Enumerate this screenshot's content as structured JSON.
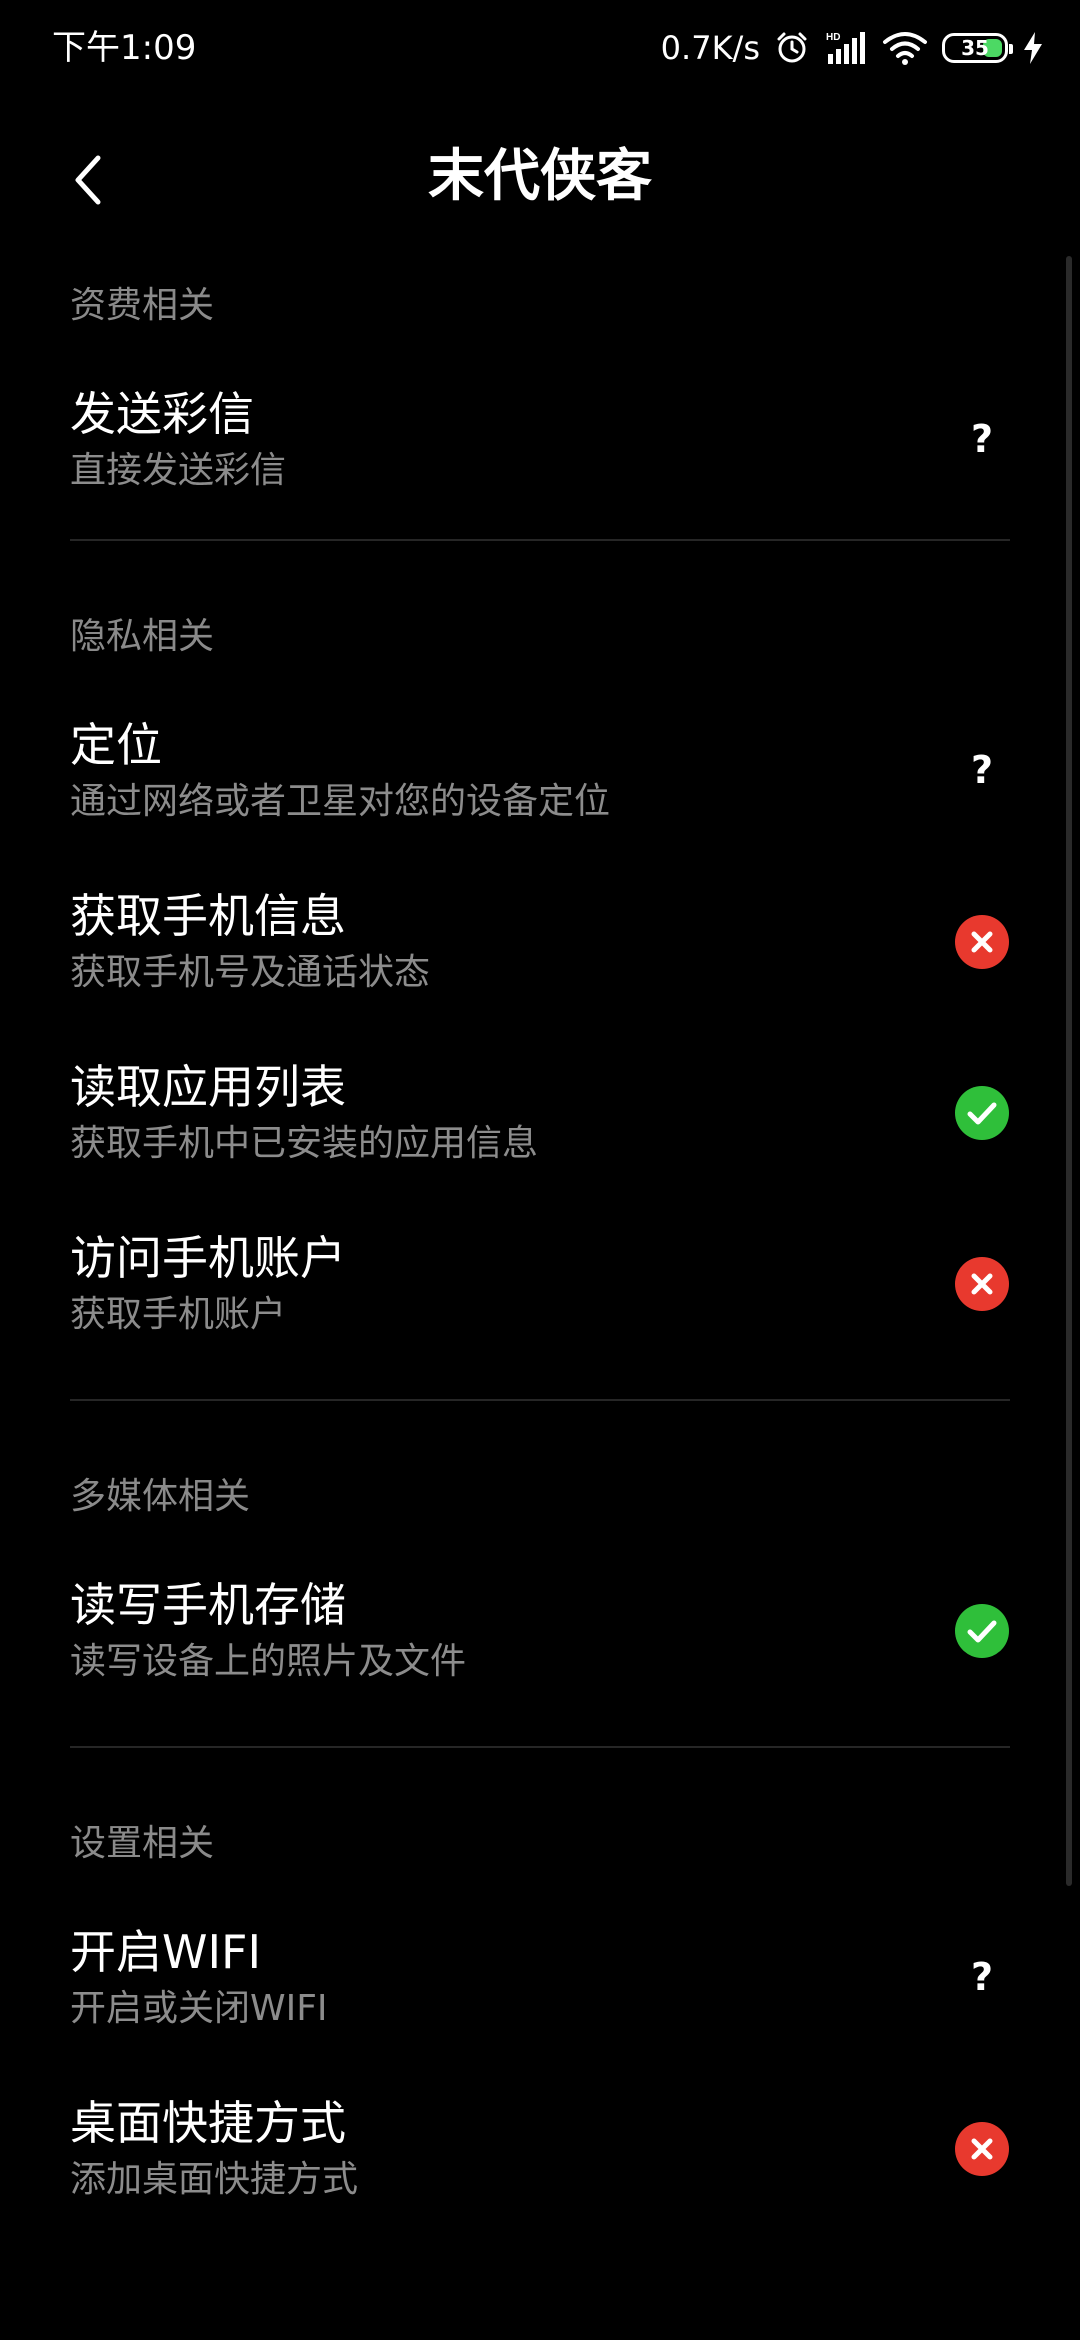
{
  "status_bar": {
    "time": "下午1:09",
    "net_speed": "0.7K/s",
    "battery_level": "35",
    "icons": [
      "alarm-icon",
      "hd-signal-icon",
      "wifi-icon",
      "battery-icon",
      "charging-icon"
    ],
    "battery_color": "#4cd964"
  },
  "header": {
    "title": "末代侠客",
    "back_icon": "chevron-left-icon"
  },
  "colors": {
    "background": "#000000",
    "allowed": "#2fbf3a",
    "denied": "#e8392e",
    "section_label": "#8a8a8a",
    "description": "#8c8c8c"
  },
  "sections": [
    {
      "label": "资费相关",
      "items": [
        {
          "title": "发送彩信",
          "desc": "直接发送彩信",
          "status": "ask",
          "icon": "question-icon"
        }
      ]
    },
    {
      "label": "隐私相关",
      "items": [
        {
          "title": "定位",
          "desc": "通过网络或者卫星对您的设备定位",
          "status": "ask",
          "icon": "question-icon"
        },
        {
          "title": "获取手机信息",
          "desc": "获取手机号及通话状态",
          "status": "denied",
          "icon": "denied-icon"
        },
        {
          "title": "读取应用列表",
          "desc": "获取手机中已安装的应用信息",
          "status": "allowed",
          "icon": "allowed-icon"
        },
        {
          "title": "访问手机账户",
          "desc": "获取手机账户",
          "status": "denied",
          "icon": "denied-icon"
        }
      ]
    },
    {
      "label": "多媒体相关",
      "items": [
        {
          "title": "读写手机存储",
          "desc": "读写设备上的照片及文件",
          "status": "allowed",
          "icon": "allowed-icon"
        }
      ]
    },
    {
      "label": "设置相关",
      "items": [
        {
          "title": "开启WIFI",
          "desc": "开启或关闭WIFI",
          "status": "ask",
          "icon": "question-icon"
        },
        {
          "title": "桌面快捷方式",
          "desc": "添加桌面快捷方式",
          "status": "denied",
          "icon": "denied-icon"
        }
      ]
    }
  ]
}
